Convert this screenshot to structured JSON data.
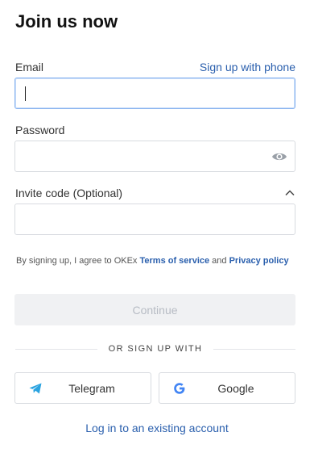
{
  "header": {
    "title": "Join us now"
  },
  "email": {
    "label": "Email",
    "switch_link": "Sign up with phone",
    "value": "",
    "placeholder": ""
  },
  "password": {
    "label": "Password",
    "value": "",
    "placeholder": "",
    "toggle_icon": "eye-icon"
  },
  "invite": {
    "label": "Invite code (Optional)",
    "value": "",
    "placeholder": "",
    "toggle_icon": "chevron-up-icon"
  },
  "terms": {
    "prefix": "By signing up, I agree to OKEx ",
    "tos": "Terms of service",
    "and": " and ",
    "privacy": "Privacy policy"
  },
  "actions": {
    "continue_label": "Continue",
    "divider": "OR SIGN UP WITH",
    "login_link": "Log in to an existing account"
  },
  "social": [
    {
      "label": "Telegram",
      "icon": "telegram-icon",
      "color": "#2aa3e0"
    },
    {
      "label": "Google",
      "icon": "google-icon",
      "color": "#4285f4"
    }
  ],
  "colors": {
    "accent": "#2a5fad",
    "focus_border": "#8ab4f0",
    "disabled_bg": "#f0f1f3",
    "disabled_text": "#b7bcc4"
  }
}
